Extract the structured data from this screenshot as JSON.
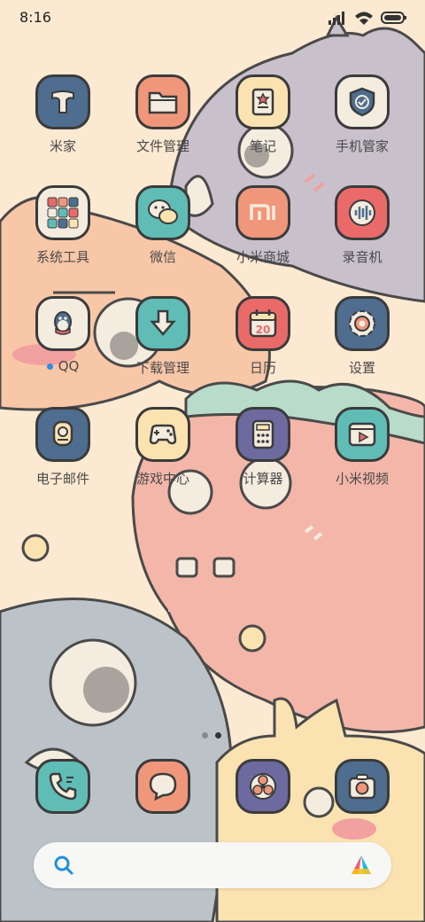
{
  "status_bar": {
    "time": "8:16"
  },
  "apps": {
    "mijia": "米家",
    "file_manager": "文件管理",
    "notes": "笔记",
    "security": "手机管家",
    "system_tools": "系统工具",
    "wechat": "微信",
    "mi_store": "小米商城",
    "recorder": "录音机",
    "qq": "QQ",
    "downloads": "下载管理",
    "calendar": "日历",
    "calendar_date": "20",
    "settings": "设置",
    "email": "电子邮件",
    "game_center": "游戏中心",
    "calculator": "计算器",
    "mi_video": "小米视频"
  },
  "dock": [
    "phone",
    "messages",
    "themes",
    "camera"
  ],
  "pager": {
    "pages": 2,
    "current": 2
  },
  "colors": {
    "blue": "#4f6d8f",
    "salmon": "#f0977b",
    "cream": "#fbe3b1",
    "red": "#ea6a6a",
    "teal": "#5fbdb6",
    "purple": "#6c6a9e",
    "background": "#fbe9d1"
  }
}
